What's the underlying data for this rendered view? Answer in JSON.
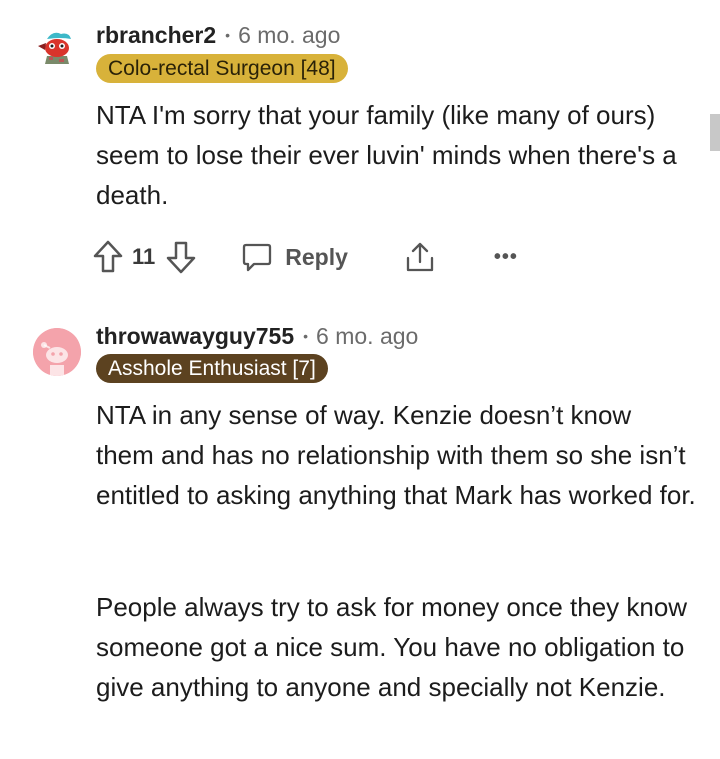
{
  "comments": [
    {
      "username": "rbrancher2",
      "separator": "•",
      "age": "6 mo. ago",
      "flair": "Colo-rectal Surgeon [48]",
      "flair_bg": "#d8b23a",
      "flair_color": "#2a2208",
      "paragraphs": [
        "NTA I'm sorry that your family (like many of ours) seem to lose their ever luvin' minds when there's a death."
      ],
      "votes": "11",
      "reply_label": "Reply",
      "more_label": "•••"
    },
    {
      "username": "throwawayguy755",
      "separator": "•",
      "age": "6 mo. ago",
      "flair": "Asshole Enthusiast [7]",
      "flair_bg": "#5c4220",
      "flair_color": "#ffffff",
      "paragraphs": [
        "NTA in any sense of way. Kenzie doesn’t know them and has no relationship with them so she isn’t entitled to asking anything that Mark has worked for.",
        "People always try to ask for money once they know someone got a nice sum. You have no obligation to give anything to anyone and specially not Kenzie."
      ]
    }
  ],
  "icons": {
    "upvote": "arrow-up-icon",
    "downvote": "arrow-down-icon",
    "reply": "speech-bubble-icon",
    "share": "share-icon",
    "more": "more-dots-icon"
  },
  "colors": {
    "flair_1": "#d8b23a",
    "flair_2": "#5c4220",
    "avatar_2_bg": "#f4a3ab"
  }
}
